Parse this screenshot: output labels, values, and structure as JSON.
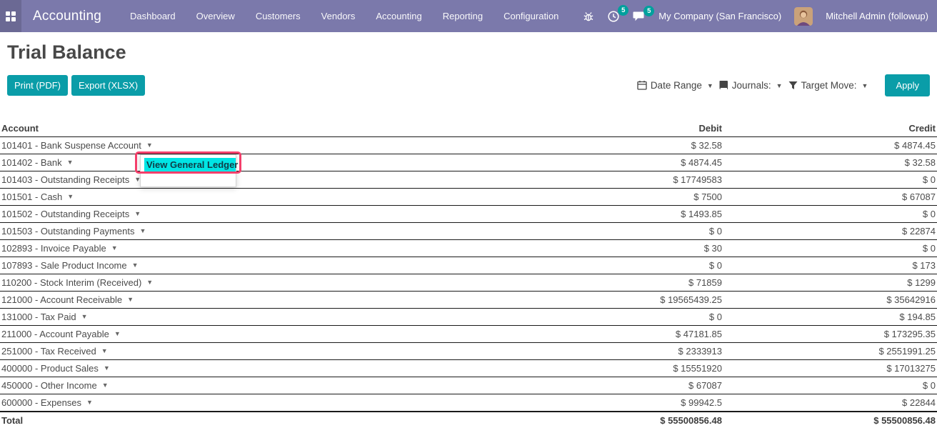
{
  "navbar": {
    "brand": "Accounting",
    "menu_items": [
      "Dashboard",
      "Overview",
      "Customers",
      "Vendors",
      "Accounting",
      "Reporting",
      "Configuration"
    ],
    "activity_badge": "5",
    "message_badge": "5",
    "company": "My Company (San Francisco)",
    "user": "Mitchell Admin (followup)"
  },
  "page": {
    "title": "Trial Balance",
    "print_label": "Print (PDF)",
    "export_label": "Export (XLSX)",
    "apply_label": "Apply",
    "filters": {
      "date_range": "Date Range",
      "journals": "Journals:",
      "target_move": "Target Move:"
    }
  },
  "dropdown": {
    "items": [
      {
        "label": "View General Ledger"
      }
    ]
  },
  "table": {
    "columns": {
      "account": "Account",
      "debit": "Debit",
      "credit": "Credit"
    },
    "rows": [
      {
        "account": "101401 - Bank Suspense Account",
        "debit": "$ 32.58",
        "credit": "$ 4874.45"
      },
      {
        "account": "101402 - Bank",
        "debit": "$ 4874.45",
        "credit": "$ 32.58"
      },
      {
        "account": "101403 - Outstanding Receipts",
        "debit": "$ 17749583",
        "credit": "$ 0"
      },
      {
        "account": "101501 - Cash",
        "debit": "$ 7500",
        "credit": "$ 67087"
      },
      {
        "account": "101502 - Outstanding Receipts",
        "debit": "$ 1493.85",
        "credit": "$ 0"
      },
      {
        "account": "101503 - Outstanding Payments",
        "debit": "$ 0",
        "credit": "$ 22874"
      },
      {
        "account": "102893 - Invoice Payable",
        "debit": "$ 30",
        "credit": "$ 0"
      },
      {
        "account": "107893 - Sale Product Income",
        "debit": "$ 0",
        "credit": "$ 173"
      },
      {
        "account": "110200 - Stock Interim (Received)",
        "debit": "$ 71859",
        "credit": "$ 1299"
      },
      {
        "account": "121000 - Account Receivable",
        "debit": "$ 19565439.25",
        "credit": "$ 35642916"
      },
      {
        "account": "131000 - Tax Paid",
        "debit": "$ 0",
        "credit": "$ 194.85"
      },
      {
        "account": "211000 - Account Payable",
        "debit": "$ 47181.85",
        "credit": "$ 173295.35"
      },
      {
        "account": "251000 - Tax Received",
        "debit": "$ 2333913",
        "credit": "$ 2551991.25"
      },
      {
        "account": "400000 - Product Sales",
        "debit": "$ 15551920",
        "credit": "$ 17013275"
      },
      {
        "account": "450000 - Other Income",
        "debit": "$ 67087",
        "credit": "$ 0"
      },
      {
        "account": "600000 - Expenses",
        "debit": "$ 99942.5",
        "credit": "$ 22844"
      }
    ],
    "total": {
      "label": "Total",
      "debit": "$ 55500856.48",
      "credit": "$ 55500856.48"
    }
  },
  "colors": {
    "navbar_bg": "#7b79ab",
    "apps_button_bg": "#6b6994",
    "accent_teal": "#0a9da8",
    "badge_teal": "#00a09d",
    "highlight_cyan": "#00e5e5",
    "annotation_red": "#f43f6b"
  }
}
